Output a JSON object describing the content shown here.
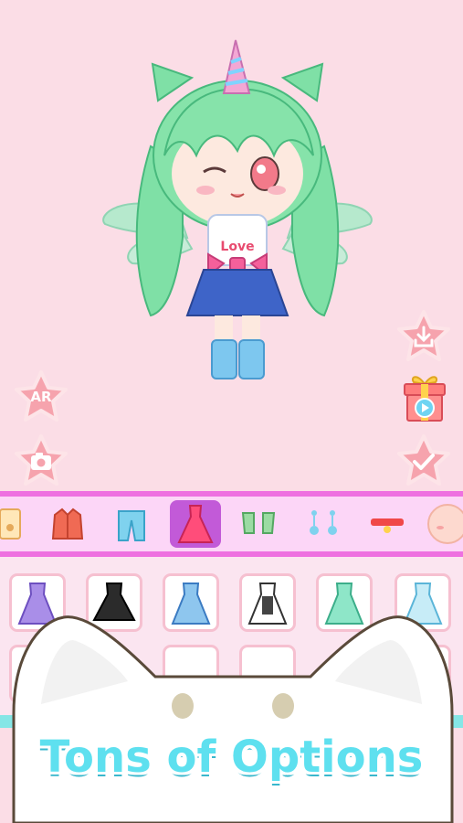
{
  "buttons": {
    "ar_label": "AR"
  },
  "banner": {
    "text": "Tons of Options"
  },
  "character": {
    "shirt_text": "Love"
  },
  "tabs": [
    {
      "icon": "paw-icon"
    },
    {
      "icon": "jacket-icon"
    },
    {
      "icon": "pants-icon"
    },
    {
      "icon": "dress-icon",
      "selected": true
    },
    {
      "icon": "socks-icon"
    },
    {
      "icon": "earrings-icon"
    },
    {
      "icon": "choker-icon"
    },
    {
      "icon": "face-icon"
    }
  ],
  "colors": {
    "background": "#fbdde6",
    "star_button": "#f6a3ad",
    "tab_bar": "#ee70e0",
    "tab_active": "#c25ad8",
    "banner_text": "#5ee0ef"
  }
}
